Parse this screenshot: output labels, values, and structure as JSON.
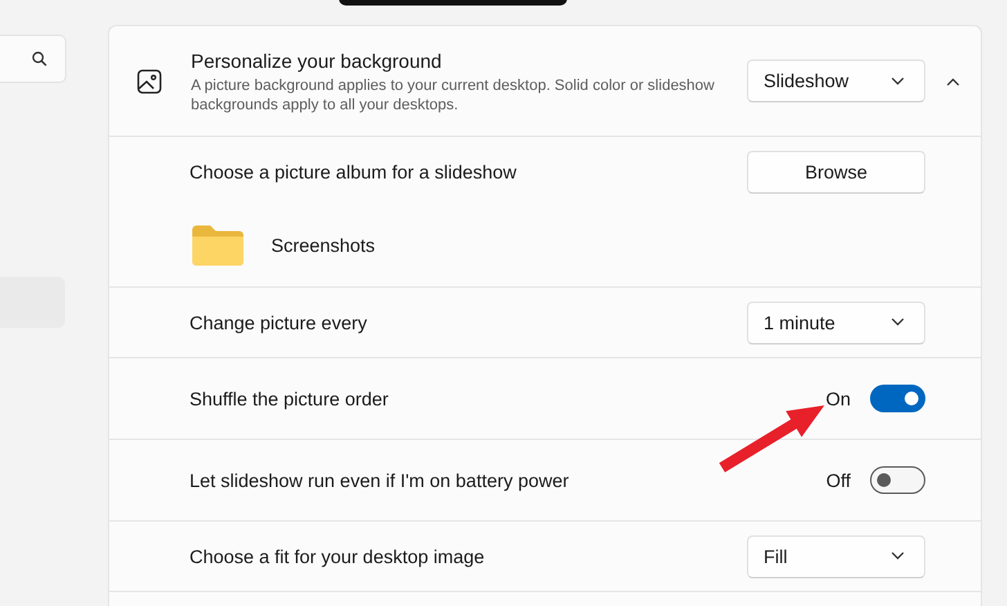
{
  "background": {
    "title": "Personalize your background",
    "description": "A picture background applies to your current desktop. Solid color or slideshow backgrounds apply to all your desktops.",
    "mode": "Slideshow",
    "expanded": true
  },
  "rows": [
    {
      "kind": "album",
      "label": "Choose a picture album for a slideshow",
      "button": "Browse",
      "album": "Screenshots"
    },
    {
      "kind": "dropdown",
      "label": "Change picture every",
      "value": "1 minute"
    },
    {
      "kind": "toggle",
      "label": "Shuffle the picture order",
      "state_text": "On",
      "on": true
    },
    {
      "kind": "toggle",
      "label": "Let slideshow run even if I'm on battery power",
      "state_text": "Off",
      "on": false
    },
    {
      "kind": "dropdown",
      "label": "Choose a fit for your desktop image",
      "value": "Fill"
    }
  ]
}
